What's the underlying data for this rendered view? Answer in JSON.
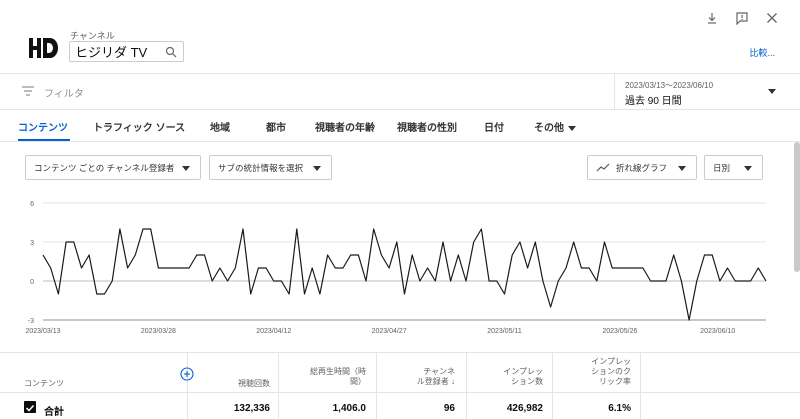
{
  "header": {
    "channel_caption": "チャンネル",
    "channel_name": "ヒジリダ TV",
    "compare_label": "比較..."
  },
  "filter": {
    "placeholder": "フィルタ",
    "date_range": "2023/03/13～2023/06/10",
    "date_label": "過去 90 日間"
  },
  "tabs": [
    {
      "label": "コンテンツ",
      "active": true
    },
    {
      "label": "トラフィック ソース"
    },
    {
      "label": "地域"
    },
    {
      "label": "都市"
    },
    {
      "label": "視聴者の年齢"
    },
    {
      "label": "視聴者の性別"
    },
    {
      "label": "日付"
    },
    {
      "label": "その他"
    }
  ],
  "controls": {
    "metric_select": "コンテンツ ごとの チャンネル登録者",
    "sub_select": "サブの統計情報を選択",
    "chart_type": "折れ線グラフ",
    "granularity": "日別"
  },
  "chart_data": {
    "type": "line",
    "y_ticks": [
      "6",
      "3",
      "0",
      "-3"
    ],
    "ylim": [
      -3,
      6
    ],
    "x_ticks": [
      "2023/03/13",
      "2023/03/28",
      "2023/04/12",
      "2023/04/27",
      "2023/05/11",
      "2023/05/26",
      "2023/06/10"
    ],
    "grid": true,
    "series": [
      {
        "values": [
          2,
          1,
          -1,
          3,
          3,
          1,
          2,
          -1,
          -1,
          0,
          4,
          1,
          2,
          4,
          4,
          1,
          1,
          1,
          1,
          1,
          2,
          2,
          0,
          1,
          0,
          1,
          4,
          -1,
          1,
          1,
          0,
          0,
          -1,
          4,
          -1,
          1,
          -1,
          2,
          1,
          1,
          2,
          2,
          0,
          4,
          2,
          1,
          3,
          -1,
          2,
          0,
          1,
          0,
          3,
          0,
          2,
          0,
          3,
          4,
          0,
          0,
          -1,
          2,
          3,
          1,
          3,
          0,
          -2,
          0,
          1,
          3,
          1,
          1,
          0,
          3,
          1,
          1,
          1,
          1,
          1,
          0,
          0,
          0,
          2,
          0,
          -3,
          0,
          2,
          2,
          0,
          1,
          0,
          0,
          0,
          1,
          0
        ]
      }
    ]
  },
  "table": {
    "columns": [
      "コンテンツ",
      "視聴回数",
      "総再生時間（時間）",
      "チャンネル登録者",
      "インプレッション数",
      "インプレッションのクリック率"
    ],
    "header_lines": {
      "content": "コンテンツ",
      "views": "視聴回数",
      "watch_1": "総再生時間（時",
      "watch_2": "間）",
      "subs_1": "チャンネ",
      "subs_2": "ル登録者",
      "subs_sort": "↓",
      "imp_1": "インプレッ",
      "imp_2": "ション数",
      "ctr_1": "インプレッ",
      "ctr_2": "ションのク",
      "ctr_3": "リック率"
    },
    "total": {
      "label": "合計",
      "views": "132,336",
      "watch_hours": "1,406.0",
      "subscribers": "96",
      "impressions": "426,982",
      "ctr": "6.1%"
    }
  },
  "colors": {
    "accent": "#065fd4"
  },
  "icons": [
    "download-icon",
    "feedback-icon",
    "close-icon",
    "search-icon",
    "filter-icon",
    "trend-icon",
    "add-icon"
  ]
}
